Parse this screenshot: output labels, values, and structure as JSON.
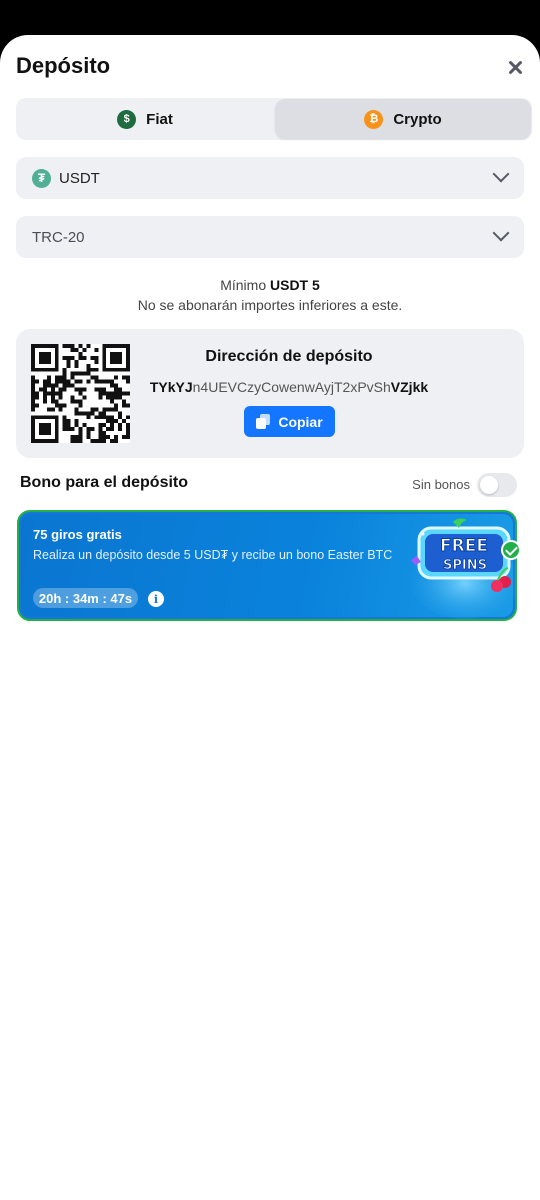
{
  "header": {
    "title": "Depósito"
  },
  "tabs": [
    {
      "label": "Fiat",
      "icon": "dollar-icon",
      "selected": false
    },
    {
      "label": "Crypto",
      "icon": "bitcoin-icon",
      "selected": true
    }
  ],
  "currency": {
    "value": "USDT",
    "icon": "tether-icon"
  },
  "network": {
    "value": "TRC-20"
  },
  "minimum": {
    "label": "Mínimo",
    "amount": "USDT 5",
    "note": "No se abonarán importes inferiores a este."
  },
  "deposit_address": {
    "title": "Dirección de depósito",
    "address_start": "TYkYJ",
    "address_middle": "n4UEVCzyCowenwAyjT2xPvSh",
    "address_end": "VZjkk",
    "copy_label": "Copiar"
  },
  "bonus": {
    "section_label": "Bono para el depósito",
    "no_bonus_label": "Sin bonos",
    "no_bonus_enabled": false,
    "card": {
      "title": "75 giros gratis",
      "description": "Realiza un depósito desde 5 USD₮ y recibe un bono Easter BTC",
      "timer": "20h : 34m : 47s",
      "info_icon": "info-icon",
      "selected": true,
      "art_line1": "FREE",
      "art_line2": "SPINS"
    }
  },
  "colors": {
    "accent": "#1476ff",
    "card_bg": "#0a7ed8",
    "selected_border": "#22b04a"
  }
}
